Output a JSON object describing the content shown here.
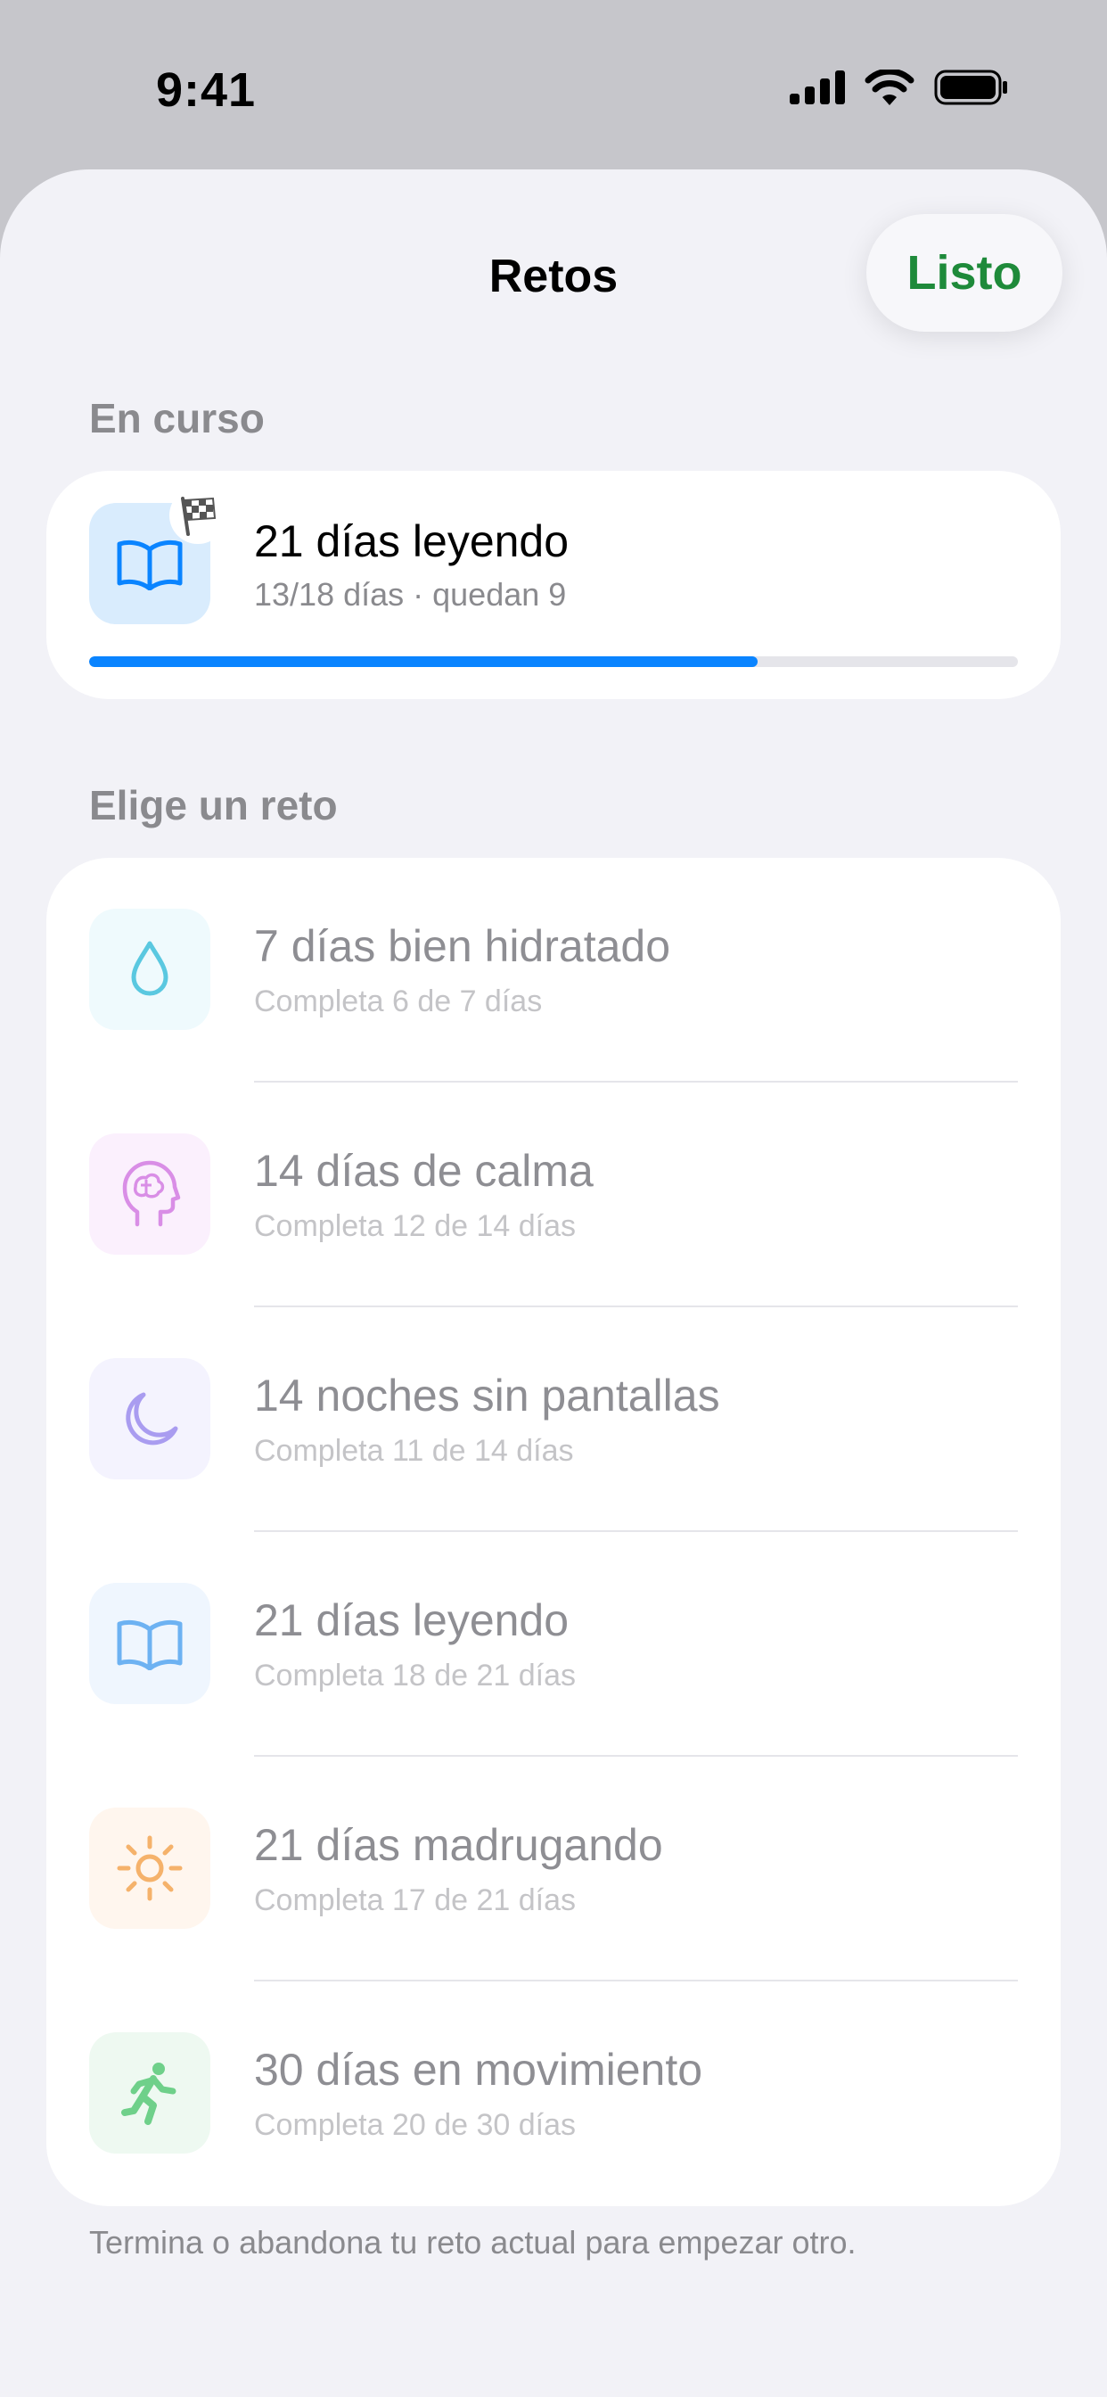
{
  "status_bar": {
    "time": "9:41"
  },
  "nav": {
    "title": "Retos",
    "done_label": "Listo"
  },
  "current": {
    "header": "En curso",
    "title": "21 días leyendo",
    "subtitle": "13/18 días · quedan 9",
    "progress": 0.72,
    "icon": "book-icon",
    "badge_icon": "checkered-flag-icon",
    "accent": "#0a84ff"
  },
  "choose": {
    "header": "Elige un reto",
    "items": [
      {
        "title": "7 días bien hidratado",
        "subtitle": "Completa 6 de 7 días",
        "icon": "water-drop-icon",
        "color": "#5ac8e0"
      },
      {
        "title": "14 días de calma",
        "subtitle": "Completa 12 de 14 días",
        "icon": "brain-head-icon",
        "color": "#d98ee6"
      },
      {
        "title": "14 noches sin pantallas",
        "subtitle": "Completa 11 de 14 días",
        "icon": "moon-icon",
        "color": "#a99cf0"
      },
      {
        "title": "21 días leyendo",
        "subtitle": "Completa 18 de 21 días",
        "icon": "book-icon",
        "color": "#6db2f2"
      },
      {
        "title": "21 días madrugando",
        "subtitle": "Completa 17 de 21 días",
        "icon": "sun-icon",
        "color": "#f5b26b"
      },
      {
        "title": "30 días en movimiento",
        "subtitle": "Completa 20 de 30 días",
        "icon": "running-figure-icon",
        "color": "#6fd08a"
      }
    ]
  },
  "footer": {
    "note": "Termina o abandona tu reto actual para empezar otro."
  }
}
